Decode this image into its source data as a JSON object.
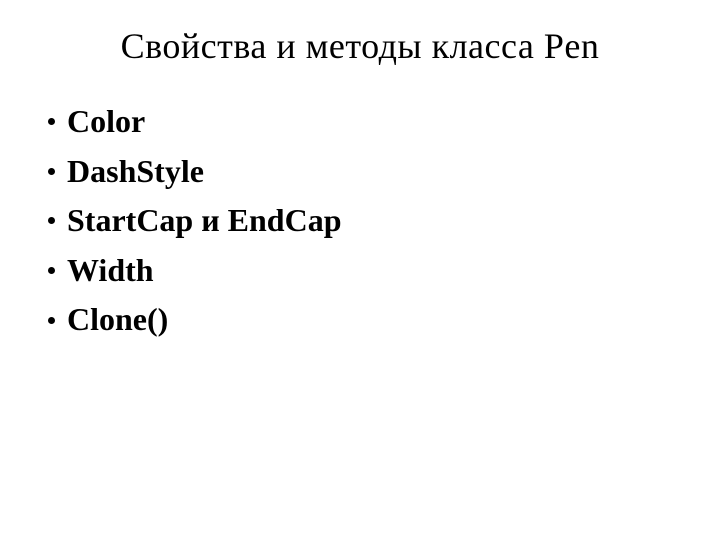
{
  "slide": {
    "title": "Свойства и методы класса Pen",
    "bullets": [
      "Color",
      "DashStyle",
      "StartCap и EndCap",
      "Width",
      "Clone()"
    ]
  }
}
